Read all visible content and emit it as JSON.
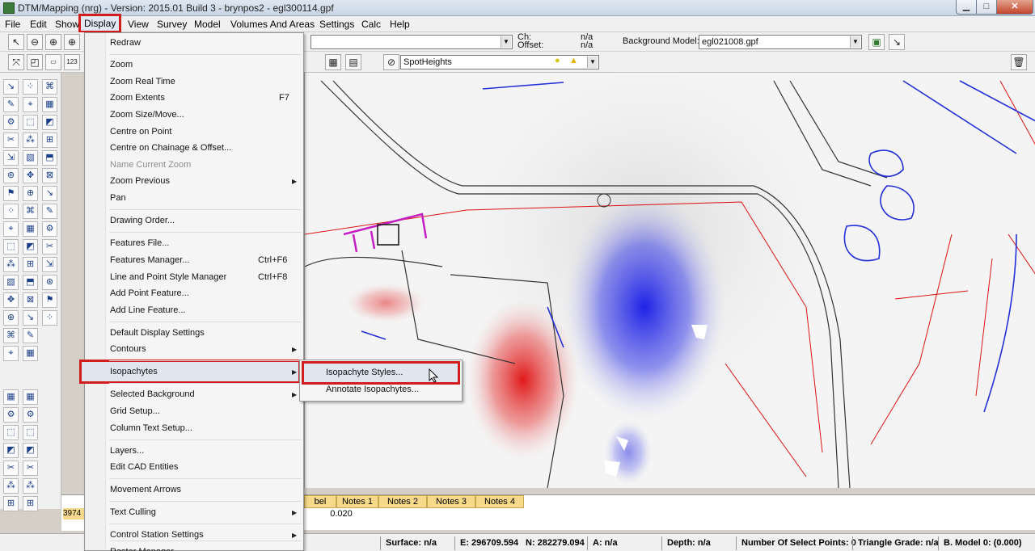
{
  "window": {
    "title": "DTM/Mapping (nrg) - Version: 2015.01 Build 3 - brynpos2 - egl300114.gpf",
    "minimize_glyph": "▁",
    "maximize_glyph": "□",
    "close_glyph": "✕"
  },
  "menubar": [
    "File",
    "Edit",
    "Show",
    "Display",
    "View",
    "Survey",
    "Model",
    "Volumes And Areas",
    "Settings",
    "Calc",
    "Help"
  ],
  "toolbar": {
    "ch_label": "Ch:",
    "offset_label": "Offset:",
    "ch_value": "n/a",
    "offset_value": "n/a",
    "background_model_label": "Background Model:",
    "background_model_value": "egl021008.gpf",
    "feature_value": "SpotHeights"
  },
  "display_menu": {
    "items": [
      {
        "label": "Redraw"
      },
      {
        "label": "Zoom"
      },
      {
        "label": "Zoom Real Time"
      },
      {
        "label": "Zoom Extents",
        "shortcut": "F7"
      },
      {
        "label": "Zoom Size/Move..."
      },
      {
        "label": "Centre on Point"
      },
      {
        "label": "Centre on Chainage & Offset..."
      },
      {
        "label": "Name Current Zoom",
        "disabled": true
      },
      {
        "label": "Zoom Previous",
        "submenu": true
      },
      {
        "label": "Pan"
      },
      {
        "label": "Drawing Order..."
      },
      {
        "label": "Features File..."
      },
      {
        "label": "Features Manager...",
        "shortcut": "Ctrl+F6"
      },
      {
        "label": "Line and Point Style Manager",
        "shortcut": "Ctrl+F8"
      },
      {
        "label": "Add Point Feature..."
      },
      {
        "label": "Add Line Feature..."
      },
      {
        "label": "Default Display Settings"
      },
      {
        "label": "Contours",
        "submenu": true
      },
      {
        "label": "Isopachytes",
        "submenu": true,
        "highlighted": true
      },
      {
        "label": "Selected Background",
        "submenu": true
      },
      {
        "label": "Grid Setup..."
      },
      {
        "label": "Column Text Setup..."
      },
      {
        "label": "Layers..."
      },
      {
        "label": "Edit CAD Entities"
      },
      {
        "label": "Movement Arrows"
      },
      {
        "label": "Text Culling",
        "submenu": true
      },
      {
        "label": "Control Station Settings",
        "submenu": true
      },
      {
        "label": "Raster Manager..."
      }
    ]
  },
  "isopachytes_submenu": [
    "Isopachyte Styles...",
    "Annotate Isopachytes..."
  ],
  "grid": {
    "headers": [
      "bel",
      "Notes 1",
      "Notes 2",
      "Notes 3",
      "Notes 4"
    ],
    "row_id": "3974",
    "row_notes1": "0.020"
  },
  "statusbar": {
    "surface": "Surface: n/a",
    "easting": "E: 296709.594",
    "northing": "N: 282279.094",
    "area": "A: n/a",
    "depth": "Depth: n/a",
    "select_points": "Number Of Select Points: 0",
    "triangle_grade": "Triangle Grade: n/a",
    "b_model": "B. Model 0: (0.000)"
  },
  "colors": {
    "highlight_border": "#d21d1d",
    "menu_bg": "#f5f5f5",
    "grid_header": "#f6d98a",
    "isopachyte_positive": "#1e22e6",
    "isopachyte_negative": "#e01818"
  },
  "icons": [
    "select-arrow-icon",
    "zoom-in-icon",
    "zoom-out-icon",
    "zoom-window-icon",
    "lamp-icon",
    "warning-icon",
    "trash-icon",
    "model-icon",
    "arrow-icon"
  ]
}
